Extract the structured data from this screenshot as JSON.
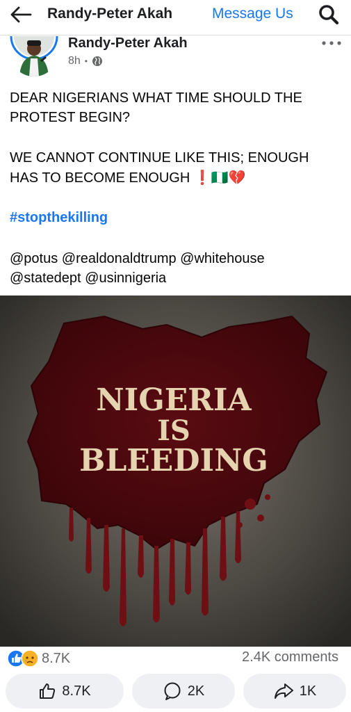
{
  "header": {
    "title": "Randy-Peter Akah",
    "message_link": "Message Us",
    "back_icon": "back-arrow-icon",
    "search_icon": "search-icon"
  },
  "post": {
    "author": "Randy-Peter Akah",
    "time": "8h",
    "separator": "•",
    "audience_icon": "globe-icon",
    "more_icon": "more-options-icon",
    "text_lines": [
      "DEAR NIGERIANS WHAT TIME SHOULD THE",
      "PROTEST BEGIN?",
      "WE CANNOT CONTINUE LIKE THIS; ENOUGH",
      "HAS TO BECOME ENOUGH"
    ],
    "emojis": "❗🇳🇬💔",
    "hashtag": "#stopthekilling",
    "mentions_line1": "@potus @realdonaldtrump @whitehouse",
    "mentions_line2": "@statedept @usinnigeria"
  },
  "image": {
    "line1": "NIGERIA",
    "line2": "IS",
    "line3": "BLEEDING"
  },
  "stats": {
    "reactions": "8.7K",
    "comments": "2.4K comments"
  },
  "actions": {
    "like": "8.7K",
    "comment": "2K",
    "share": "1K"
  },
  "colors": {
    "accent": "#1877f2",
    "blood": "#6e0f14"
  }
}
